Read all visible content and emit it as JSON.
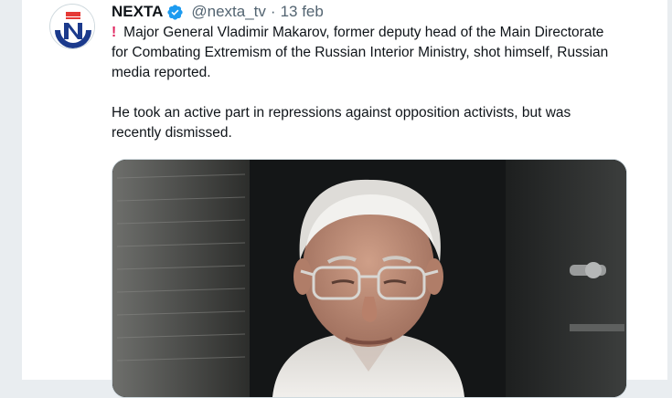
{
  "tweet": {
    "author_name": "NEXTA",
    "handle": "@nexta_tv",
    "separator": "·",
    "date": "13 feb",
    "alert_icon": "exclamation-icon",
    "paragraph_1": "Major General Vladimir Makarov, former deputy head of the Main Directorate for Combating Extremism of the Russian Interior Ministry, shot himself, Russian media reported.",
    "paragraph_2": "He took an active part in repressions against opposition activists, but was recently dismissed."
  },
  "colors": {
    "verified_blue": "#1d9bf0",
    "brand_red": "#e53935",
    "brand_navy": "#1b3a8c",
    "text_primary": "#0f1419",
    "text_secondary": "#536471"
  }
}
